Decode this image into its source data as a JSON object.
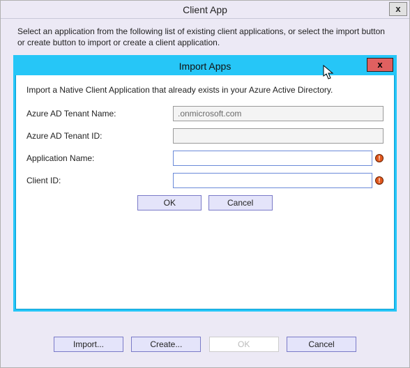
{
  "outer": {
    "title": "Client App",
    "close": "x",
    "intro": "Select an application from the following list of existing client applications, or select the import button or create button to import or create a client application.",
    "buttons": {
      "import": "Import...",
      "create": "Create...",
      "ok": "OK",
      "cancel": "Cancel"
    }
  },
  "inner": {
    "title": "Import Apps",
    "close": "x",
    "intro": "Import a Native Client Application that already exists in your Azure Active Directory.",
    "fields": {
      "tenant_name": {
        "label": "Azure AD Tenant Name:",
        "value": ".onmicrosoft.com"
      },
      "tenant_id": {
        "label": "Azure AD Tenant ID:",
        "value": ""
      },
      "app_name": {
        "label": "Application Name:",
        "value": ""
      },
      "client_id": {
        "label": "Client ID:",
        "value": ""
      }
    },
    "buttons": {
      "ok": "OK",
      "cancel": "Cancel"
    }
  }
}
